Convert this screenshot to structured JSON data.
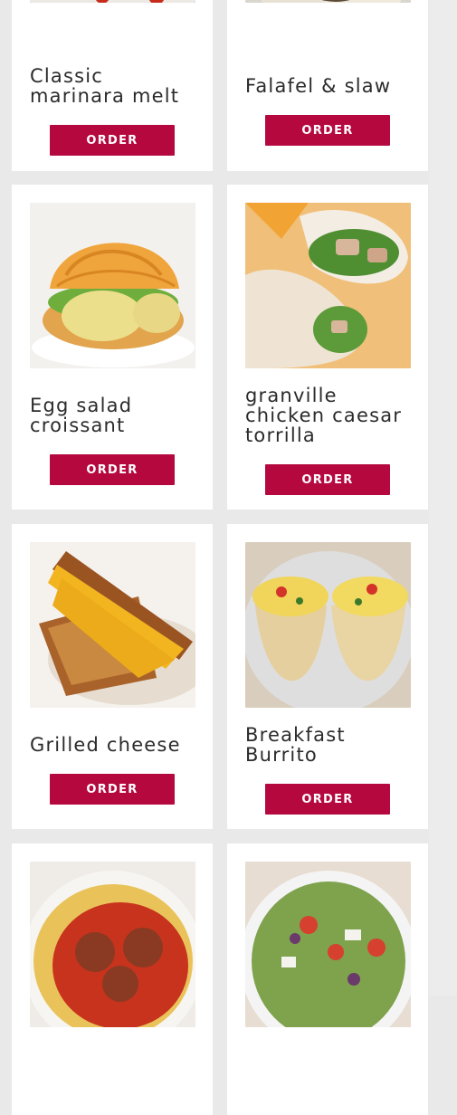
{
  "menu": {
    "items": [
      {
        "name": "Classic marinara melt",
        "button": "ORDER",
        "image_icon": "marinara-melt-photo"
      },
      {
        "name": "Falafel & slaw",
        "button": "ORDER",
        "image_icon": "falafel-slaw-photo"
      },
      {
        "name": "Egg salad croissant",
        "button": "ORDER",
        "image_icon": "egg-salad-croissant-photo"
      },
      {
        "name": "granville chicken caesar torrilla",
        "button": "ORDER",
        "image_icon": "chicken-caesar-wrap-photo"
      },
      {
        "name": "Grilled cheese",
        "button": "ORDER",
        "image_icon": "grilled-cheese-photo"
      },
      {
        "name": "Breakfast Burrito",
        "button": "ORDER",
        "image_icon": "breakfast-burrito-photo"
      },
      {
        "name": "",
        "button": "",
        "image_icon": "spaghetti-meatballs-photo"
      },
      {
        "name": "",
        "button": "",
        "image_icon": "greek-salad-photo"
      }
    ]
  },
  "colors": {
    "accent": "#b5083f",
    "card": "#ffffff",
    "background": "#e9e9e9",
    "text": "#2b2b2b"
  }
}
